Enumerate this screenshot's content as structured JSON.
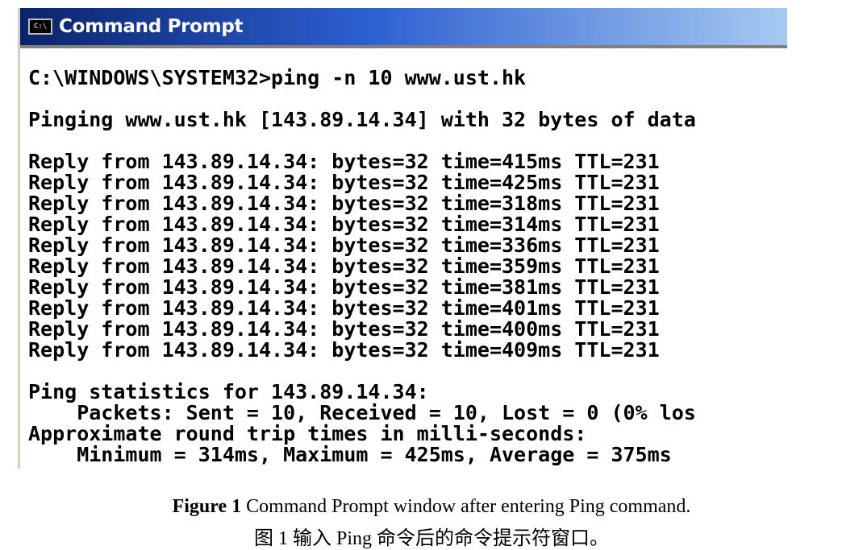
{
  "window": {
    "title": "Command Prompt",
    "icon": "cmd-icon",
    "icon_glyph": "C:\\"
  },
  "console": {
    "lines": [
      "C:\\WINDOWS\\SYSTEM32>ping -n 10 www.ust.hk",
      "",
      "Pinging www.ust.hk [143.89.14.34] with 32 bytes of data",
      "",
      "Reply from 143.89.14.34: bytes=32 time=415ms TTL=231",
      "Reply from 143.89.14.34: bytes=32 time=425ms TTL=231",
      "Reply from 143.89.14.34: bytes=32 time=318ms TTL=231",
      "Reply from 143.89.14.34: bytes=32 time=314ms TTL=231",
      "Reply from 143.89.14.34: bytes=32 time=336ms TTL=231",
      "Reply from 143.89.14.34: bytes=32 time=359ms TTL=231",
      "Reply from 143.89.14.34: bytes=32 time=381ms TTL=231",
      "Reply from 143.89.14.34: bytes=32 time=401ms TTL=231",
      "Reply from 143.89.14.34: bytes=32 time=400ms TTL=231",
      "Reply from 143.89.14.34: bytes=32 time=409ms TTL=231",
      "",
      "Ping statistics for 143.89.14.34:",
      "    Packets: Sent = 10, Received = 10, Lost = 0 (0% los",
      "Approximate round trip times in milli-seconds:",
      "    Minimum = 314ms, Maximum = 425ms, Average = 375ms"
    ]
  },
  "caption": {
    "label": "Figure 1",
    "text_en": " Command Prompt window after entering Ping command.",
    "text_zh": "图 1 输入 Ping 命令后的命令提示符窗口。"
  }
}
